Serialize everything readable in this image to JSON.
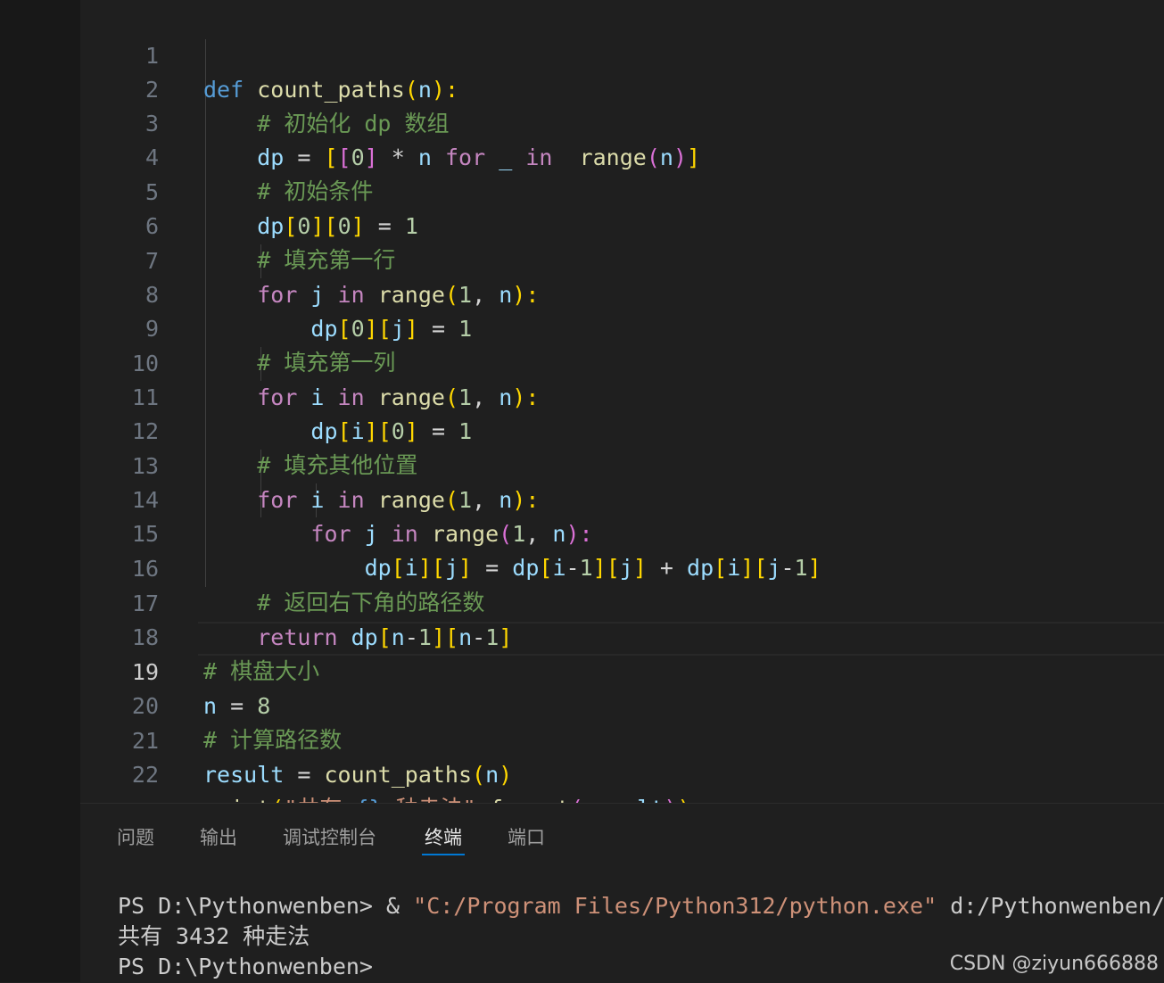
{
  "editor": {
    "line_numbers": [
      "1",
      "2",
      "3",
      "4",
      "5",
      "6",
      "7",
      "8",
      "9",
      "10",
      "11",
      "12",
      "13",
      "14",
      "15",
      "16",
      "17",
      "18",
      "19",
      "20",
      "21",
      "22"
    ],
    "current_line": "19",
    "tokens": {
      "l1": [
        "def",
        "count_paths",
        "(",
        "n",
        "):"
      ],
      "l2": [
        "# 初始化 dp 数组"
      ],
      "l3": [
        "dp",
        " = ",
        "[",
        "[",
        "0",
        "]",
        " * ",
        "n",
        " for ",
        "_",
        " in ",
        "range",
        "(",
        "n",
        ")",
        "]"
      ],
      "l4": [
        "# 初始条件"
      ],
      "l5": [
        "dp",
        "[",
        "0",
        "]",
        "[",
        "0",
        "]",
        " = ",
        "1"
      ],
      "l6": [
        "# 填充第一行"
      ],
      "l7": [
        "for",
        " j ",
        "in",
        " ",
        "range",
        "(",
        "1",
        ", ",
        "n",
        "):"
      ],
      "l8": [
        "dp",
        "[",
        "0",
        "]",
        "[",
        "j",
        "]",
        " = ",
        "1"
      ],
      "l9": [
        "# 填充第一列"
      ],
      "l10": [
        "for",
        " i ",
        "in",
        " ",
        "range",
        "(",
        "1",
        ", ",
        "n",
        "):"
      ],
      "l11": [
        "dp",
        "[",
        "i",
        "]",
        "[",
        "0",
        "]",
        " = ",
        "1"
      ],
      "l12": [
        "# 填充其他位置"
      ],
      "l13": [
        "for",
        " i ",
        "in",
        " ",
        "range",
        "(",
        "1",
        ", ",
        "n",
        "):"
      ],
      "l14": [
        "for",
        " j ",
        "in",
        " ",
        "range",
        "(",
        "1",
        ", ",
        "n",
        "):"
      ],
      "l15": [
        "dp",
        "[",
        "i",
        "]",
        "[",
        "j",
        "]",
        " = ",
        "dp",
        "[",
        "i",
        "-",
        "1",
        "]",
        "[",
        "j",
        "]",
        " + ",
        "dp",
        "[",
        "i",
        "]",
        "[",
        "j",
        "-",
        "1",
        "]"
      ],
      "l16": [
        "# 返回右下角的路径数"
      ],
      "l17": [
        "return",
        " ",
        "dp",
        "[",
        "n",
        "-",
        "1",
        "]",
        "[",
        "n",
        "-",
        "1",
        "]"
      ],
      "l18": [
        "# 棋盘大小"
      ],
      "l19": [
        "n",
        " = ",
        "8"
      ],
      "l20": [
        "# 计算路径数"
      ],
      "l21": [
        "result",
        " = ",
        "count_paths",
        "(",
        "n",
        ")"
      ],
      "l22": [
        "print",
        "(",
        "\"共有 ",
        "{}",
        " 种走法\"",
        ".",
        "format",
        "(",
        "result",
        ")",
        ")"
      ]
    }
  },
  "panel": {
    "tabs": [
      "问题",
      "输出",
      "调试控制台",
      "终端",
      "端口"
    ],
    "active_tab": "终端"
  },
  "terminal": {
    "line1_prompt": "PS D:\\Pythonwenben> & ",
    "line1_exe": "\"C:/Program Files/Python312/python.exe\"",
    "line1_arg": " d:/Pythonwenben/",
    "line2": "共有 3432 种走法",
    "line3": "PS D:\\Pythonwenben>"
  },
  "watermark": "CSDN @ziyun666888",
  "colors": {
    "background": "#1f1f1f",
    "keyword": "#569cd6",
    "control": "#c586c0",
    "function": "#dcdcaa",
    "variable": "#9cdcfe",
    "number": "#b5cea8",
    "string": "#ce9178",
    "comment": "#6a9955",
    "accent": "#0078d4"
  }
}
